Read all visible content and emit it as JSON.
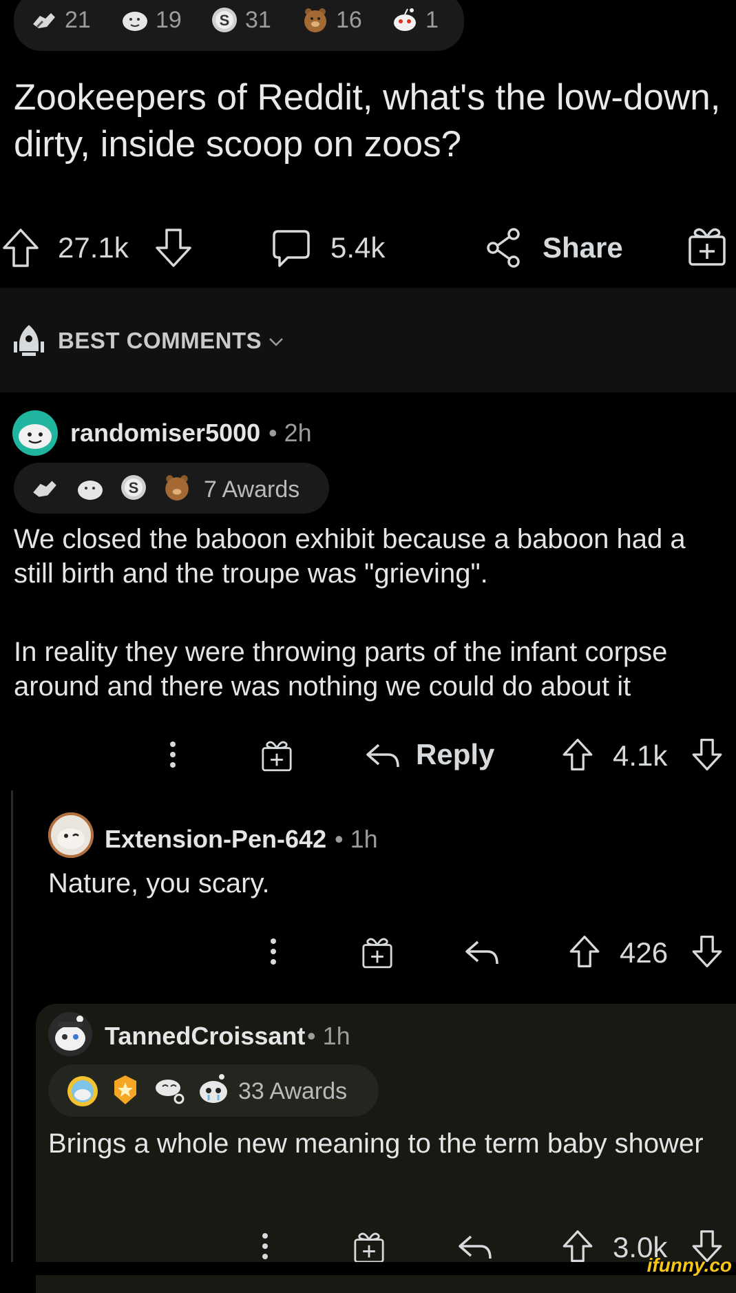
{
  "post": {
    "awards": [
      {
        "icon": "handshake-award-icon",
        "count": "21"
      },
      {
        "icon": "wholesome-seal-award-icon",
        "count": "19"
      },
      {
        "icon": "silver-award-icon",
        "count": "31"
      },
      {
        "icon": "bear-hug-award-icon",
        "count": "16"
      },
      {
        "icon": "snoo-award-icon",
        "count": "1"
      }
    ],
    "title": "Zookeepers of Reddit, what's the low-down, dirty, inside scoop on zoos?",
    "upvotes": "27.1k",
    "comments": "5.4k",
    "share_label": "Share"
  },
  "sort": {
    "label": "BEST COMMENTS"
  },
  "comments": [
    {
      "username": "randomiser5000",
      "time": "• 2h",
      "awards_label": "7 Awards",
      "award_icons": [
        "handshake-award-icon",
        "wholesome-seal-award-icon",
        "silver-award-icon",
        "bear-hug-award-icon"
      ],
      "paragraphs": [
        "We closed the baboon exhibit because a baboon had a still birth and the troupe was \"grieving\".",
        "In reality they were throwing parts of the infant corpse around and there was nothing we could do about it"
      ],
      "reply_label": "Reply",
      "score": "4.1k"
    },
    {
      "username": "Extension-Pen-642",
      "time": "• 1h",
      "paragraphs": [
        "Nature, you scary."
      ],
      "score": "426"
    },
    {
      "username": "TannedCroissant",
      "time": "• 1h",
      "awards_label": "33 Awards",
      "award_icons": [
        "sun-award-icon",
        "star-award-icon",
        "tea-award-icon",
        "snoo-tears-award-icon"
      ],
      "paragraphs": [
        "Brings a whole new meaning to the term baby shower"
      ],
      "score": "3.0k"
    }
  ],
  "watermark": "ifunny.co",
  "colors": {
    "background": "#000000",
    "panel": "#1a1a1b",
    "text": "#d7dadc",
    "muted": "#9a9c9e",
    "highlight_reply": "#191914"
  }
}
